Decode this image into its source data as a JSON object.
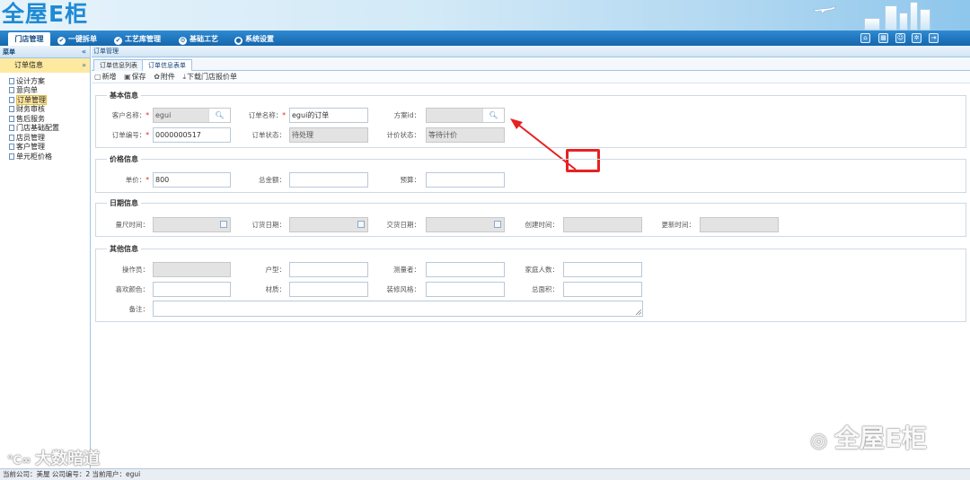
{
  "header": {
    "logo_text": "全屋E柜"
  },
  "nav": {
    "tabs": [
      {
        "label": "门店管理",
        "active": true
      },
      {
        "label": "一键拆单"
      },
      {
        "label": "工艺库管理"
      },
      {
        "label": "基础工艺"
      },
      {
        "label": "系统设置"
      }
    ]
  },
  "left": {
    "title": "菜单",
    "collapse": "«",
    "section": "订单信息",
    "section_arrow": "»",
    "items": [
      "设计方案",
      "意向单",
      "订单管理",
      "财务审核",
      "售后服务",
      "门店基础配置",
      "店员管理",
      "客户管理",
      "单元柜价格"
    ],
    "selected_index": 2
  },
  "main": {
    "breadcrumb": "订单管理",
    "tabs": [
      "订单信息列表",
      "订单信息表单"
    ],
    "toolbar": {
      "add": "新增",
      "save": "保存",
      "attach": "附件",
      "download": "下载门店报价单"
    }
  },
  "form": {
    "basic": {
      "legend": "基本信息",
      "customer_label": "客户名称：",
      "customer_value": "egui",
      "order_name_label": "订单名称：",
      "order_name_value": "egui的订单",
      "scheme_label": "方案id：",
      "scheme_value": "",
      "order_no_label": "订单编号：",
      "order_no_value": "0000000517",
      "status_label": "订单状态：",
      "status_value": "待处理",
      "price_status_label": "计价状态：",
      "price_status_value": "等待计价"
    },
    "price": {
      "legend": "价格信息",
      "unit_label": "单价：",
      "unit_value": "800",
      "total_label": "总金额：",
      "total_value": "",
      "budget_label": "预算：",
      "budget_value": ""
    },
    "date": {
      "legend": "日期信息",
      "measure_label": "量尺时间：",
      "order_date_label": "订货日期：",
      "delivery_label": "交货日期：",
      "create_label": "创建时间：",
      "update_label": "更新时间："
    },
    "other": {
      "legend": "其他信息",
      "operator_label": "操作员：",
      "house_label": "户型：",
      "measurer_label": "测量者：",
      "family_label": "家庭人数：",
      "color_label": "喜欢颜色：",
      "material_label": "材质：",
      "style_label": "装修风格：",
      "area_label": "总面积：",
      "remark_label": "备注："
    }
  },
  "status_bar": "当前公司：美屋    公司编号：2    当前用户：egui",
  "watermarks": {
    "left": "大数暗道",
    "right": "全屋E柜"
  },
  "colors": {
    "nav": "#1567ad",
    "highlight": "#e52222",
    "selected": "#fde9a0"
  }
}
